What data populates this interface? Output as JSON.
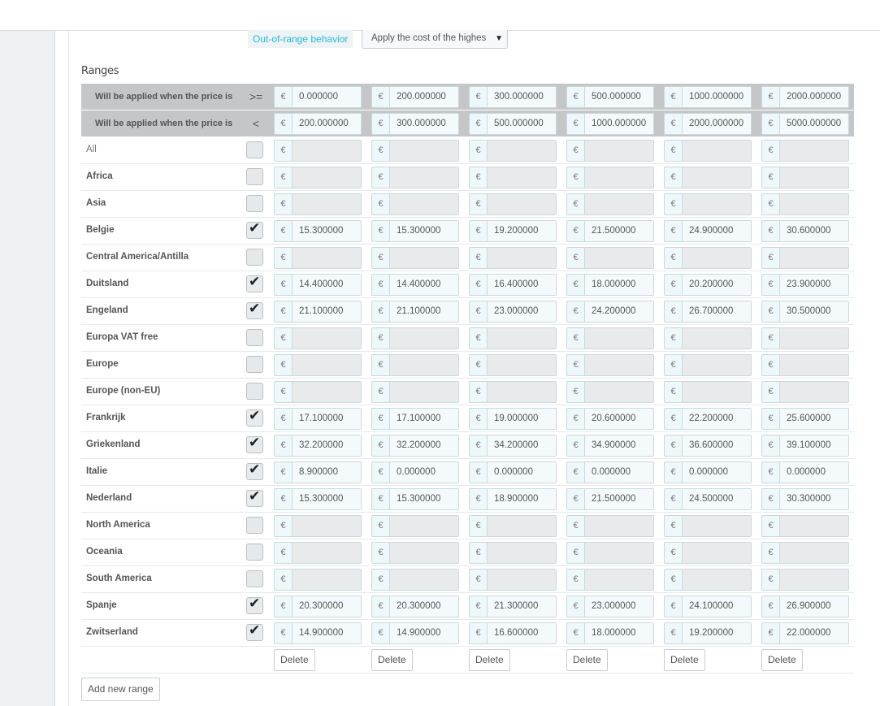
{
  "out_of_range": {
    "label": "Out-of-range behavior",
    "selected": "Apply the cost of the highes",
    "caret": "▼"
  },
  "ranges_title": "Ranges",
  "currency": "€",
  "header_rows": [
    {
      "label": "Will be applied when the price is",
      "operator": ">=",
      "values": [
        "0.000000",
        "200.000000",
        "300.000000",
        "500.000000",
        "1000.000000",
        "2000.000000"
      ]
    },
    {
      "label": "Will be applied when the price is",
      "operator": "<",
      "values": [
        "200.000000",
        "300.000000",
        "500.000000",
        "1000.000000",
        "2000.000000",
        "5000.000000"
      ]
    }
  ],
  "zones": [
    {
      "name": "All",
      "checked": false,
      "values": [
        "",
        "",
        "",
        "",
        "",
        ""
      ]
    },
    {
      "name": "Africa",
      "checked": false,
      "values": [
        "",
        "",
        "",
        "",
        "",
        ""
      ]
    },
    {
      "name": "Asia",
      "checked": false,
      "values": [
        "",
        "",
        "",
        "",
        "",
        ""
      ]
    },
    {
      "name": "Belgie",
      "checked": true,
      "values": [
        "15.300000",
        "15.300000",
        "19.200000",
        "21.500000",
        "24.900000",
        "30.600000"
      ]
    },
    {
      "name": "Central America/Antilla",
      "checked": false,
      "values": [
        "",
        "",
        "",
        "",
        "",
        ""
      ]
    },
    {
      "name": "Duitsland",
      "checked": true,
      "values": [
        "14.400000",
        "14.400000",
        "16.400000",
        "18.000000",
        "20.200000",
        "23.900000"
      ]
    },
    {
      "name": "Engeland",
      "checked": true,
      "values": [
        "21.100000",
        "21.100000",
        "23.000000",
        "24.200000",
        "26.700000",
        "30.500000"
      ]
    },
    {
      "name": "Europa VAT free",
      "checked": false,
      "values": [
        "",
        "",
        "",
        "",
        "",
        ""
      ]
    },
    {
      "name": "Europe",
      "checked": false,
      "values": [
        "",
        "",
        "",
        "",
        "",
        ""
      ]
    },
    {
      "name": "Europe (non-EU)",
      "checked": false,
      "values": [
        "",
        "",
        "",
        "",
        "",
        ""
      ]
    },
    {
      "name": "Frankrijk",
      "checked": true,
      "values": [
        "17.100000",
        "17.100000",
        "19.000000",
        "20.600000",
        "22.200000",
        "25.600000"
      ]
    },
    {
      "name": "Griekenland",
      "checked": true,
      "values": [
        "32.200000",
        "32.200000",
        "34.200000",
        "34.900000",
        "36.600000",
        "39.100000"
      ]
    },
    {
      "name": "Italie",
      "checked": true,
      "values": [
        "8.900000",
        "0.000000",
        "0.000000",
        "0.000000",
        "0.000000",
        "0.000000"
      ]
    },
    {
      "name": "Nederland",
      "checked": true,
      "values": [
        "15.300000",
        "15.300000",
        "18.900000",
        "21.500000",
        "24.500000",
        "30.300000"
      ]
    },
    {
      "name": "North America",
      "checked": false,
      "values": [
        "",
        "",
        "",
        "",
        "",
        ""
      ]
    },
    {
      "name": "Oceania",
      "checked": false,
      "values": [
        "",
        "",
        "",
        "",
        "",
        ""
      ]
    },
    {
      "name": "South America",
      "checked": false,
      "values": [
        "",
        "",
        "",
        "",
        "",
        ""
      ]
    },
    {
      "name": "Spanje",
      "checked": true,
      "values": [
        "20.300000",
        "20.300000",
        "21.300000",
        "23.000000",
        "24.100000",
        "26.900000"
      ]
    },
    {
      "name": "Zwitserland",
      "checked": true,
      "values": [
        "14.900000",
        "14.900000",
        "16.600000",
        "18.000000",
        "19.200000",
        "22.000000"
      ]
    }
  ],
  "delete_label": "Delete",
  "add_range_label": "Add new range",
  "checkmark": "✔"
}
